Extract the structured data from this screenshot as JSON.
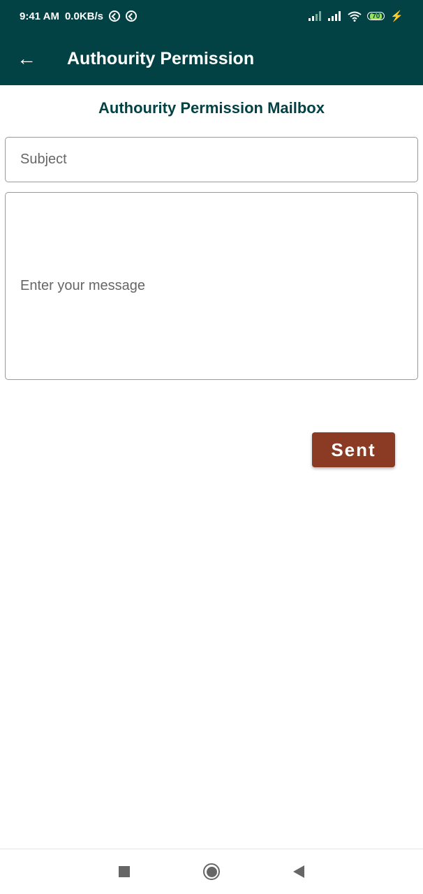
{
  "status_bar": {
    "time": "9:41 AM",
    "speed": "0.0KB/s",
    "battery": "70"
  },
  "app_bar": {
    "title": "Authourity Permission",
    "back_icon": "arrow-left-icon"
  },
  "main": {
    "heading": "Authourity Permission Mailbox",
    "subject_placeholder": "Subject",
    "message_placeholder": "Enter your message",
    "send_label": "Sent"
  },
  "colors": {
    "primary": "#024245",
    "button": "#8b3a24"
  }
}
